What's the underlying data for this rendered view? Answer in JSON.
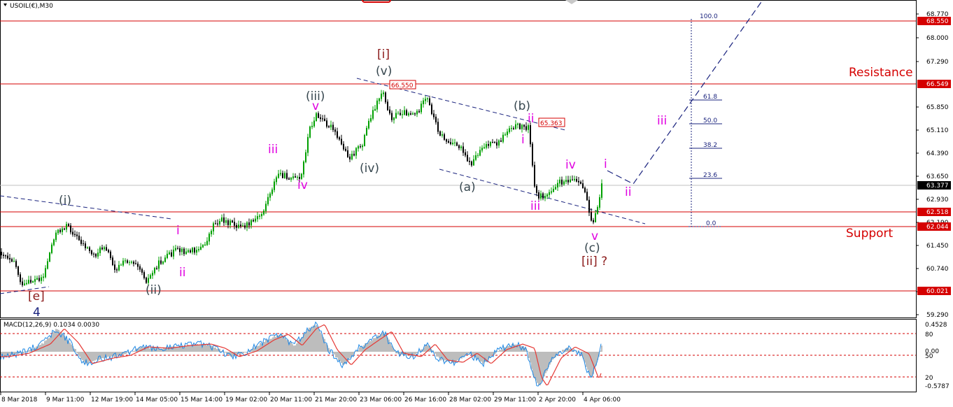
{
  "header": {
    "symbol_label": "USOIL(€),M30"
  },
  "indicator": {
    "label": "MACD(12,26,9) 0.1034 0.0030",
    "scale": [
      "0.4528",
      "80",
      "0.00",
      "50",
      "20",
      "-0.5787"
    ]
  },
  "price_axis": {
    "ticks": [
      "68.770",
      "68.000",
      "67.290",
      "65.850",
      "65.110",
      "64.390",
      "63.650",
      "62.930",
      "62.190",
      "61.450",
      "60.740",
      "60.000",
      "59.290"
    ],
    "highlights": [
      {
        "value": "68.550",
        "color": "#d50000"
      },
      {
        "value": "66.549",
        "color": "#d50000"
      },
      {
        "value": "63.377",
        "color": "#000000"
      },
      {
        "value": "62.518",
        "color": "#d50000"
      },
      {
        "value": "62.044",
        "color": "#d50000"
      },
      {
        "value": "60.021",
        "color": "#d50000"
      }
    ]
  },
  "time_axis": {
    "labels": [
      "8 Mar 2018",
      "9 Mar 11:00",
      "12 Mar 19:00",
      "14 Mar 05:00",
      "15 Mar 14:00",
      "19 Mar 02:00",
      "20 Mar 11:00",
      "21 Mar 20:00",
      "23 Mar 06:00",
      "26 Mar 16:00",
      "28 Mar 02:00",
      "29 Mar 11:00",
      "2 Apr 20:00",
      "4 Apr 06:00"
    ]
  },
  "levels": {
    "resistance_label": "Resistance",
    "support_label": "Support",
    "price_boxes": [
      "66.550",
      "65.363"
    ]
  },
  "fibonacci": {
    "levels": [
      "100.0",
      "61.8",
      "50.0",
      "38.2",
      "23.6",
      "0.0"
    ]
  },
  "wave_labels": {
    "e": "[e]",
    "four": "4",
    "i_paren": "(i)",
    "ii_paren": "(ii)",
    "iii_paren": "(iii)",
    "iv_paren": "(iv)",
    "v_paren": "(v)",
    "i_bracket": "[i]",
    "a_paren": "(a)",
    "b_paren": "(b)",
    "c_paren": "(c)",
    "ii_bracket": "[ii] ?",
    "m_i_1": "i",
    "m_ii_1": "ii",
    "m_iii_1": "iii",
    "m_iv_1": "iv",
    "m_v_1": "v",
    "m_i_2": "i",
    "m_ii_2": "ii",
    "m_iii_2": "iii",
    "m_iv_2": "iv",
    "m_v_2": "v",
    "m_i_3": "i",
    "m_ii_3": "ii",
    "m_iii_3": "iii"
  },
  "colors": {
    "up_candle": "#00a000",
    "down_candle": "#000000",
    "level_line": "#d50000",
    "trend_line": "#1a237e",
    "wave_magenta": "#e000e0",
    "wave_gray": "#37474f",
    "wave_darkred": "#8b1a1a",
    "macd_histogram": "#bdbdbd",
    "macd_main": "#1e88e5",
    "macd_signal": "#e53935"
  }
}
